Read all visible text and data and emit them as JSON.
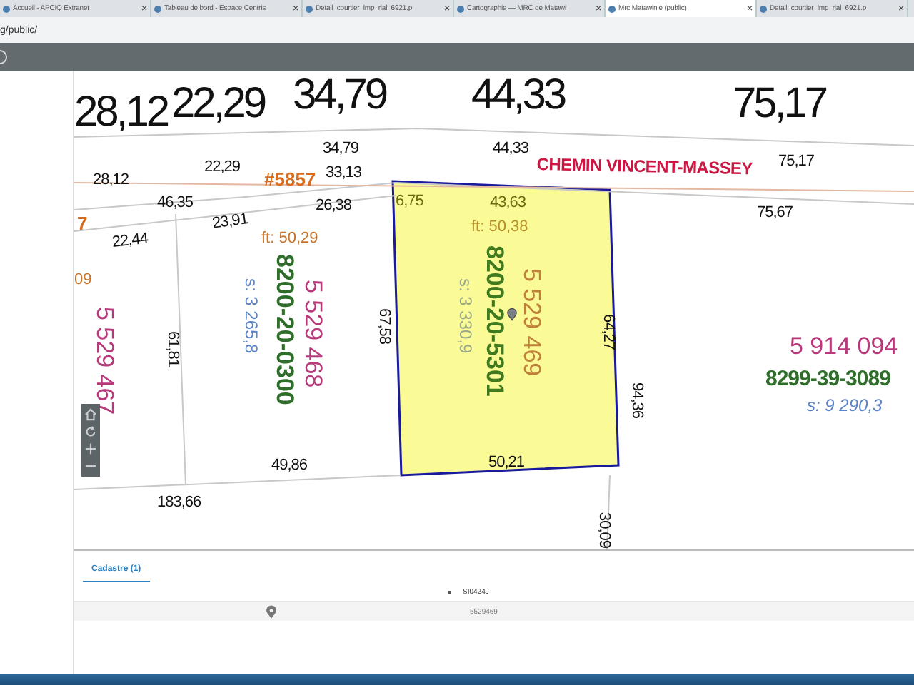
{
  "browser": {
    "tabs": [
      {
        "title": "Accueil - APCIQ Extranet",
        "selected": false,
        "close": "×"
      },
      {
        "title": "Tableau de bord - Espace Centris",
        "selected": false,
        "close": "×"
      },
      {
        "title": "Detail_courtier_lmp_rial_6921.p",
        "selected": false,
        "close": "×"
      },
      {
        "title": "Cartographie — MRC de Matawi",
        "selected": false,
        "close": "×"
      },
      {
        "title": "Mrc Matawinie (public)",
        "selected": true,
        "close": "×"
      },
      {
        "title": "Detail_courtier_lmp_rial_6921.p",
        "selected": false,
        "close": "×"
      }
    ],
    "address": "g/public/"
  },
  "map": {
    "big_dimensions": [
      "28,12",
      "22,29",
      "34,79",
      "44,33",
      "75,17"
    ],
    "road": {
      "name": "CHEMIN VINCENT-MASSEY"
    },
    "labels": [
      {
        "kind": "dimension",
        "text": "28,12"
      },
      {
        "kind": "dimension",
        "text": "22,29"
      },
      {
        "kind": "dimension",
        "text": "34,79"
      },
      {
        "kind": "civic",
        "text": "#5857"
      },
      {
        "kind": "dimension",
        "text": "33,13"
      },
      {
        "kind": "dimension",
        "text": "44,33"
      },
      {
        "kind": "dimension",
        "text": "75,17"
      },
      {
        "kind": "dimension",
        "text": "46,35"
      },
      {
        "kind": "dimension",
        "text": "26,38"
      },
      {
        "kind": "dimension",
        "text": "23,91"
      },
      {
        "kind": "dimension",
        "text": "22,44"
      },
      {
        "kind": "dimension",
        "text": "75,67"
      },
      {
        "kind": "civic",
        "text": "7"
      },
      {
        "kind": "dimension",
        "text": "6,75"
      },
      {
        "kind": "dimension",
        "text": "43,63"
      },
      {
        "kind": "dimension",
        "text": "67,58"
      },
      {
        "kind": "dimension",
        "text": "61,81"
      },
      {
        "kind": "dimension",
        "text": "64,27"
      },
      {
        "kind": "dimension",
        "text": "94,36"
      },
      {
        "kind": "dimension",
        "text": "49,86"
      },
      {
        "kind": "dimension",
        "text": "50,21"
      },
      {
        "kind": "dimension",
        "text": "183,66"
      },
      {
        "kind": "dimension",
        "text": "30,09"
      }
    ],
    "parcels": [
      {
        "selected": false,
        "frontage": "09",
        "lot_number": "5 529 467"
      },
      {
        "selected": false,
        "frontage": "ft: 50,29",
        "lot_number": "5 529 468",
        "matricule": "8200-20-0300",
        "area": "s: 3 265,8"
      },
      {
        "selected": true,
        "frontage": "ft: 50,38",
        "lot_number": "5 529 469",
        "matricule": "8200-20-5301",
        "area": "s: 3 330,9"
      },
      {
        "selected": false,
        "lot_number": "5 914 094",
        "matricule": "8299-39-3089",
        "area": "s: 9 290,3"
      }
    ]
  },
  "results": {
    "tabs": [
      {
        "label": "Cadastre (1)",
        "selected": true
      }
    ],
    "columns": [
      "SI0424J"
    ],
    "rows": [
      {
        "cells": [
          "5529469"
        ]
      }
    ]
  }
}
